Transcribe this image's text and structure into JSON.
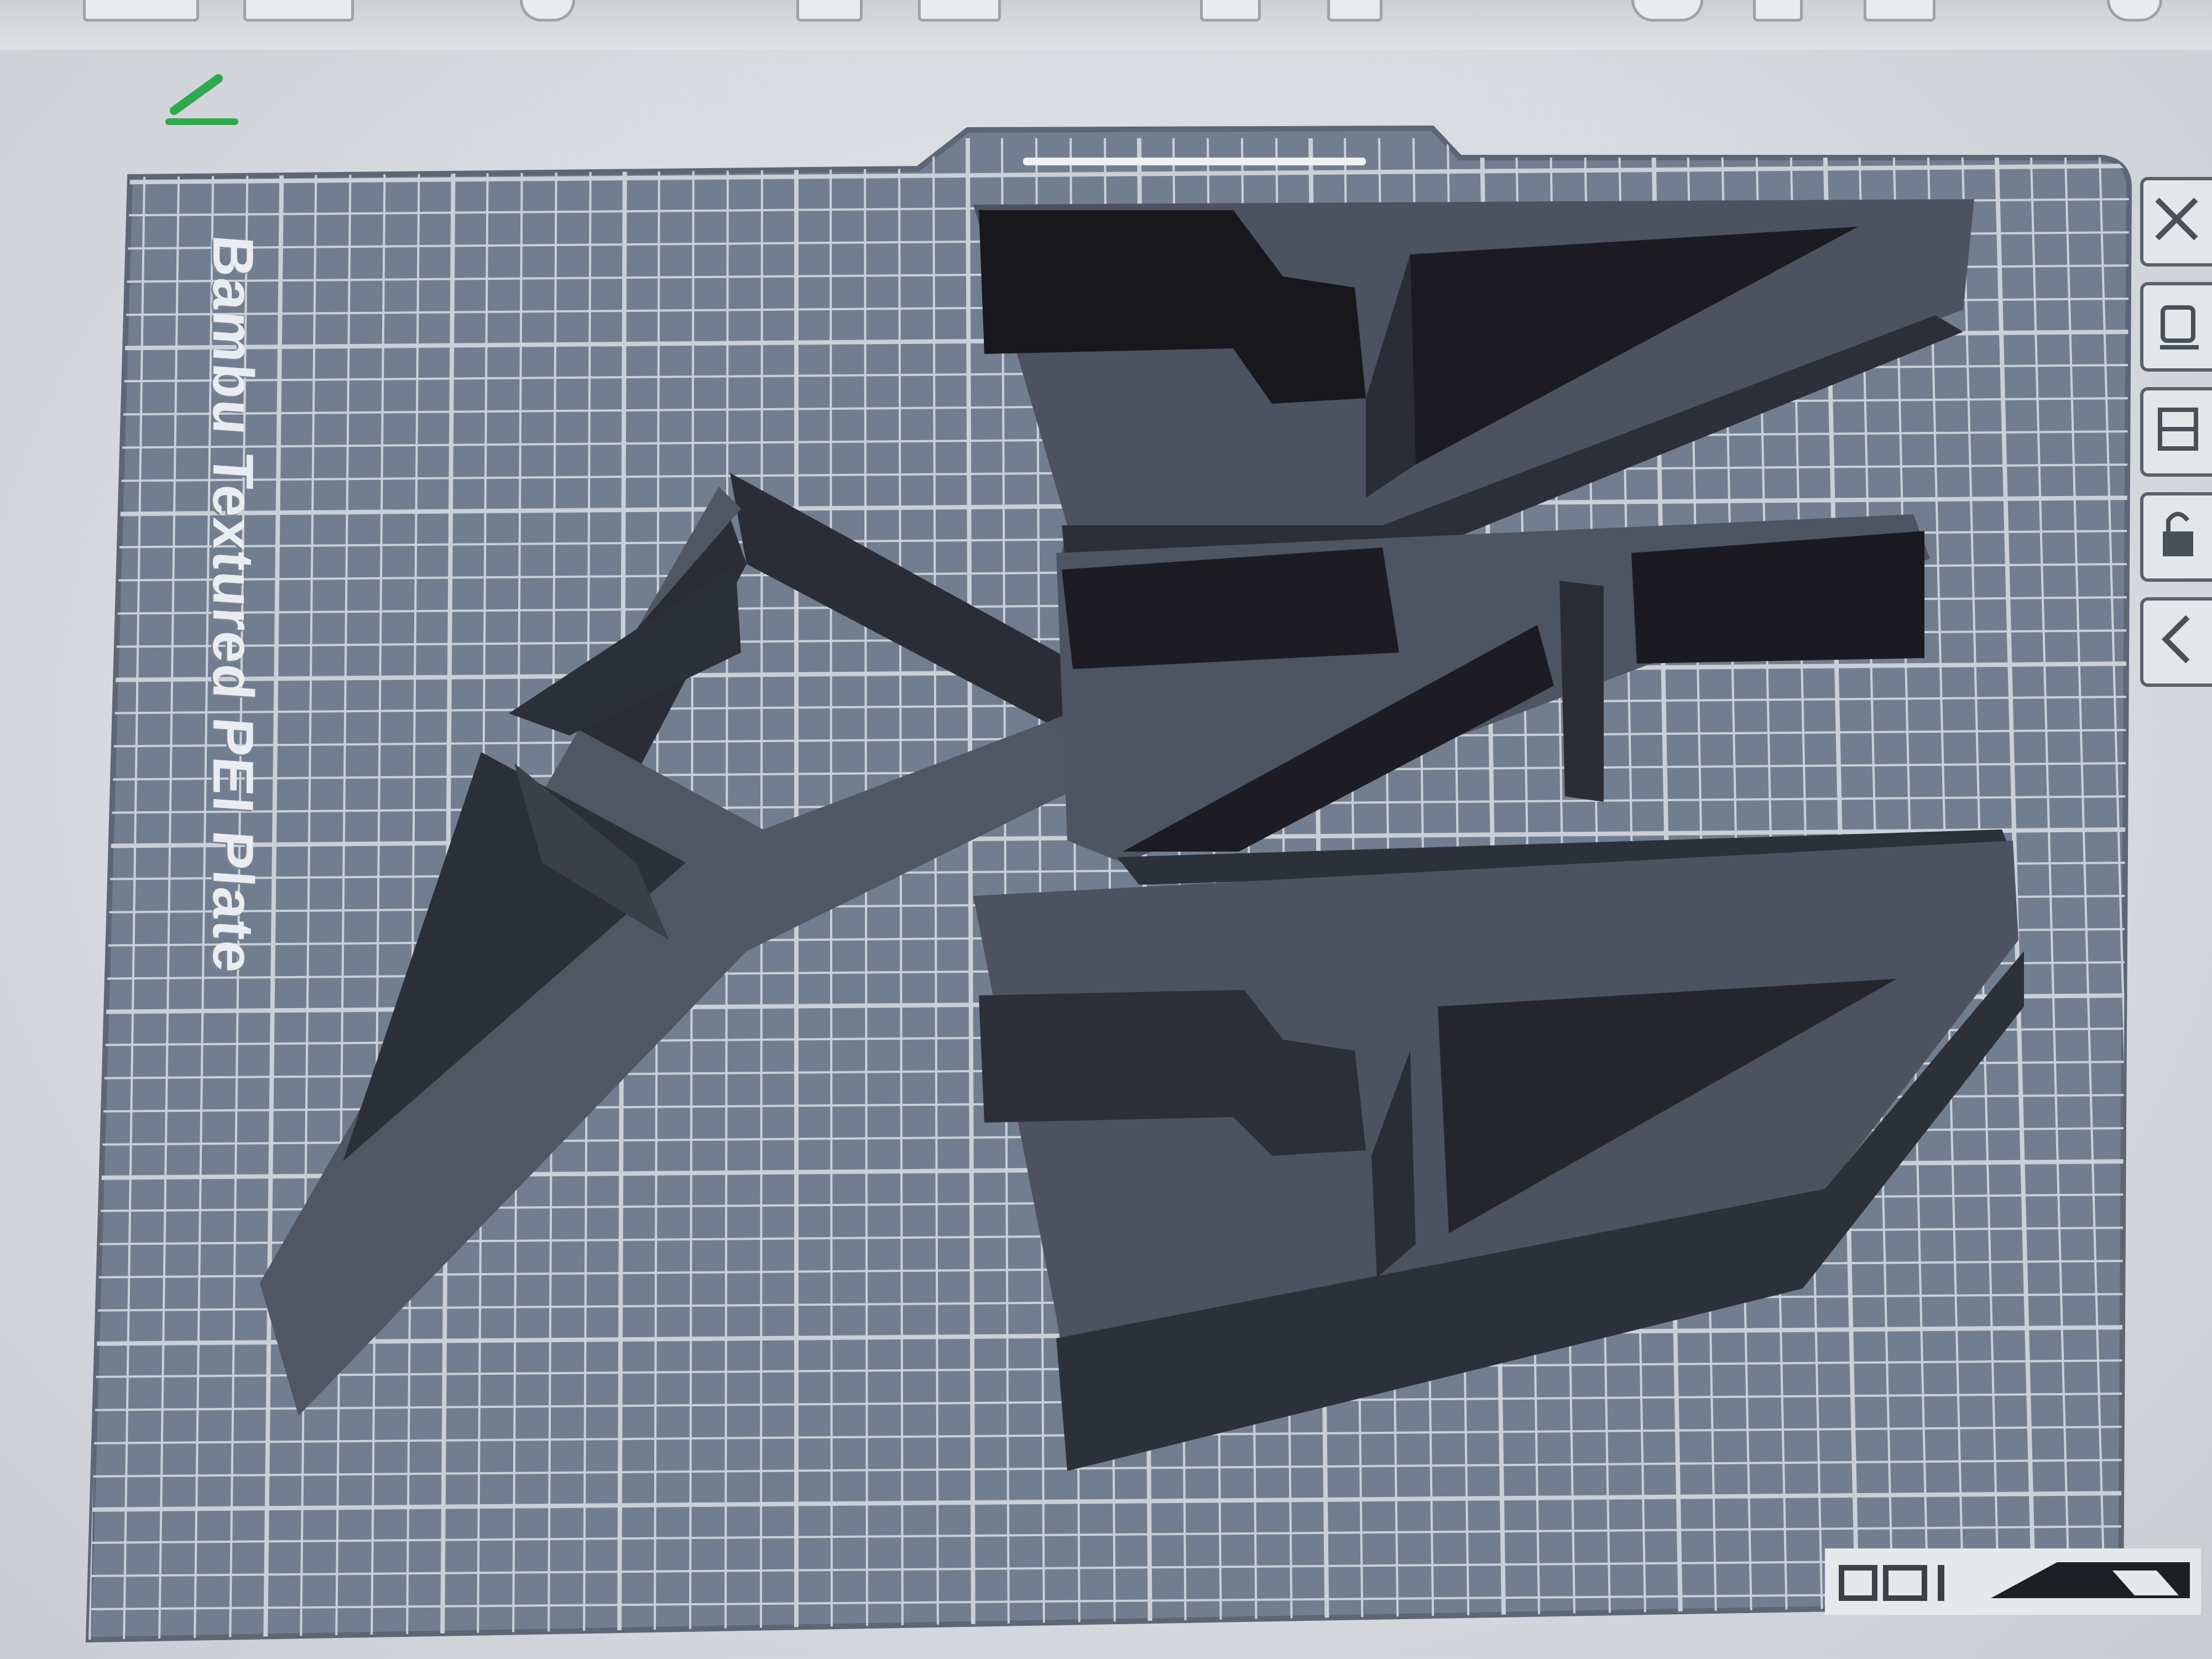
{
  "plate": {
    "name": "Bambu Textured PEI Plate"
  },
  "colors": {
    "plate": "#707d8e",
    "grid": "#c9d0d8",
    "part_top": "#4e5462",
    "part_side": "#2a2d35",
    "part_dark": "#17161b",
    "accent_green": "#2fa84f"
  },
  "toolbar": {
    "icons": [
      "box-icon",
      "layout-icon",
      "cube-icon",
      "square-icon",
      "frame-icon",
      "rectangle-icon",
      "rotate-icon",
      "lock-icon",
      "texture-icon",
      "globe-icon"
    ]
  },
  "sidebar": {
    "icons": [
      "close-icon",
      "hand-icon",
      "layers-icon",
      "lock-icon",
      "back-icon"
    ]
  },
  "bottom_bar": {
    "icons": [
      "arrange-icon",
      "orient-icon",
      "slope-icon"
    ]
  }
}
